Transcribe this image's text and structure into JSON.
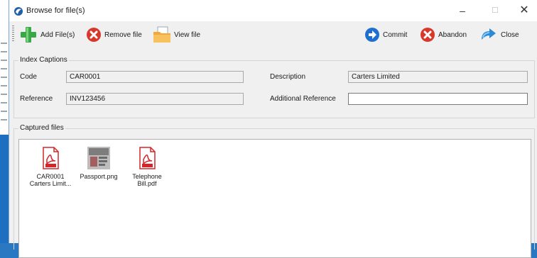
{
  "window": {
    "title": "Browse for file(s)"
  },
  "toolbar": {
    "add_files": "Add File(s)",
    "remove_file": "Remove file",
    "view_file": "View file",
    "commit": "Commit",
    "abandon": "Abandon",
    "close": "Close"
  },
  "index_captions": {
    "legend": "Index Captions",
    "code_label": "Code",
    "code_value": "CAR0001",
    "reference_label": "Reference",
    "reference_value": "INV123456",
    "description_label": "Description",
    "description_value": "Carters Limited",
    "additional_reference_label": "Additional Reference",
    "additional_reference_value": ""
  },
  "captured_files": {
    "legend": "Captured files",
    "files": [
      {
        "name_line1": "CAR0001",
        "name_line2": "Carters Limit...",
        "icon": "pdf-icon"
      },
      {
        "name_line1": "Passport.png",
        "name_line2": "",
        "icon": "image-thumbnail"
      },
      {
        "name_line1": "Telephone",
        "name_line2": "Bill.pdf",
        "icon": "pdf-icon"
      }
    ]
  },
  "colors": {
    "accent_blue": "#1f6fd0",
    "remove_red": "#d8382a",
    "add_green": "#3aa845",
    "pdf_red": "#d2262a",
    "folder_orange": "#f3a83a"
  }
}
